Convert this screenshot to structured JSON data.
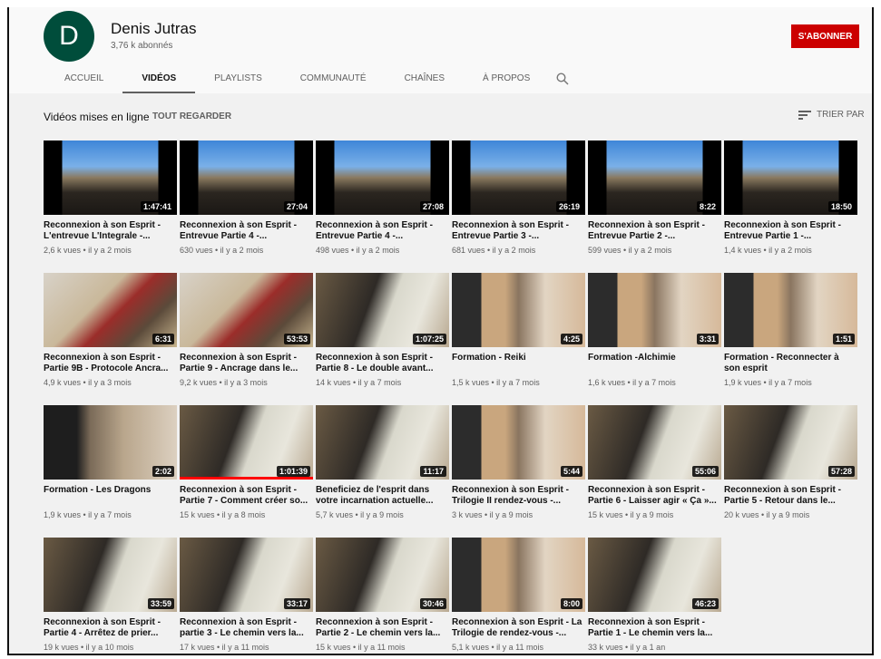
{
  "channel": {
    "avatar_letter": "D",
    "name": "Denis Jutras",
    "subscribers": "3,76 k abonnés",
    "subscribe_label": "S'ABONNER",
    "accent": "#cc0000",
    "avatar_color": "#004d3b"
  },
  "tabs": [
    {
      "label": "ACCUEIL"
    },
    {
      "label": "VIDÉOS",
      "active": true
    },
    {
      "label": "PLAYLISTS"
    },
    {
      "label": "COMMUNAUTÉ"
    },
    {
      "label": "CHAÎNES"
    },
    {
      "label": "À PROPOS"
    }
  ],
  "section": {
    "title": "Vidéos mises en ligne",
    "play_all": "TOUT REGARDER",
    "sort_label": "TRIER PAR"
  },
  "videos": [
    {
      "title": "Reconnexion à son Esprit - L'entrevue L'Integrale -...",
      "meta": "2,6 k vues • il y a 2 mois",
      "duration": "1:47:41",
      "thumb": "dogs"
    },
    {
      "title": "Reconnexion à son Esprit - Entrevue Partie 4 -...",
      "meta": "630 vues • il y a 2 mois",
      "duration": "27:04",
      "thumb": "dogs"
    },
    {
      "title": "Reconnexion à son Esprit - Entrevue Partie 4 -...",
      "meta": "498 vues • il y a 2 mois",
      "duration": "27:08",
      "thumb": "dogs"
    },
    {
      "title": "Reconnexion à son Esprit - Entrevue Partie 3 -...",
      "meta": "681 vues • il y a 2 mois",
      "duration": "26:19",
      "thumb": "dogs"
    },
    {
      "title": "Reconnexion à son Esprit - Entrevue Partie 2 -...",
      "meta": "599 vues • il y a 2 mois",
      "duration": "8:22",
      "thumb": "dogs"
    },
    {
      "title": "Reconnexion à son Esprit - Entrevue Partie 1 -...",
      "meta": "1,4 k vues • il y a 2 mois",
      "duration": "18:50",
      "thumb": "dogs"
    },
    {
      "title": "Reconnexion à son Esprit - Partie 9B - Protocole Ancra...",
      "meta": "4,9 k vues • il y a 3 mois",
      "duration": "6:31",
      "thumb": "couch"
    },
    {
      "title": "Reconnexion à son Esprit - Partie 9 - Ancrage dans le...",
      "meta": "9,2 k vues • il y a 3 mois",
      "duration": "53:53",
      "thumb": "couch"
    },
    {
      "title": "Reconnexion à son Esprit - Partie 8 - Le double avant...",
      "meta": "14 k vues • il y a 7 mois",
      "duration": "1:07:25",
      "thumb": "board"
    },
    {
      "title": "Formation - Reiki",
      "meta": "1,5 k vues • il y a 7 mois",
      "duration": "4:25",
      "thumb": "wall"
    },
    {
      "title": "Formation -Alchimie",
      "meta": "1,6 k vues • il y a 7 mois",
      "duration": "3:31",
      "thumb": "wall"
    },
    {
      "title": "Formation - Reconnecter à son esprit",
      "meta": "1,9 k vues • il y a 7 mois",
      "duration": "1:51",
      "thumb": "wall"
    },
    {
      "title": "Formation - Les Dragons",
      "meta": "1,9 k vues • il y a 7 mois",
      "duration": "2:02",
      "thumb": "dark"
    },
    {
      "title": "Reconnexion à son Esprit - Partie 7 - Comment créer so...",
      "meta": "15 k vues • il y a 8 mois",
      "duration": "1:01:39",
      "thumb": "board",
      "watched": 1.0
    },
    {
      "title": "Beneficiez de l'esprit dans votre incarnation actuelle...",
      "meta": "5,7 k vues • il y a 9 mois",
      "duration": "11:17",
      "thumb": "board"
    },
    {
      "title": "Reconnexion à son Esprit -Trilogie II rendez-vous -...",
      "meta": "3 k vues • il y a 9 mois",
      "duration": "5:44",
      "thumb": "wall"
    },
    {
      "title": "Reconnexion à son Esprit - Partie 6 - Laisser agir « Ça »...",
      "meta": "15 k vues • il y a 9 mois",
      "duration": "55:06",
      "thumb": "board"
    },
    {
      "title": "Reconnexion à son Esprit - Partie 5 - Retour dans le...",
      "meta": "20 k vues • il y a 9 mois",
      "duration": "57:28",
      "thumb": "board"
    },
    {
      "title": "Reconnexion à son Esprit - Partie 4 - Arrêtez de prier...",
      "meta": "19 k vues • il y a 10 mois",
      "duration": "33:59",
      "thumb": "board"
    },
    {
      "title": "Reconnexion à son Esprit - partie 3 - Le chemin vers la...",
      "meta": "17 k vues • il y a 11 mois",
      "duration": "33:17",
      "thumb": "board"
    },
    {
      "title": "Reconnexion à son Esprit - Partie 2 - Le chemin vers la...",
      "meta": "15 k vues • il y a 11 mois",
      "duration": "30:46",
      "thumb": "board"
    },
    {
      "title": "Reconnexion à son Esprit - La Trilogie de rendez-vous -...",
      "meta": "5,1 k vues • il y a 11 mois",
      "duration": "8:00",
      "thumb": "wall"
    },
    {
      "title": "Reconnexion à son Esprit - Partie 1 - Le chemin vers la...",
      "meta": "33 k vues • il y a 1 an",
      "duration": "46:23",
      "thumb": "board"
    }
  ]
}
